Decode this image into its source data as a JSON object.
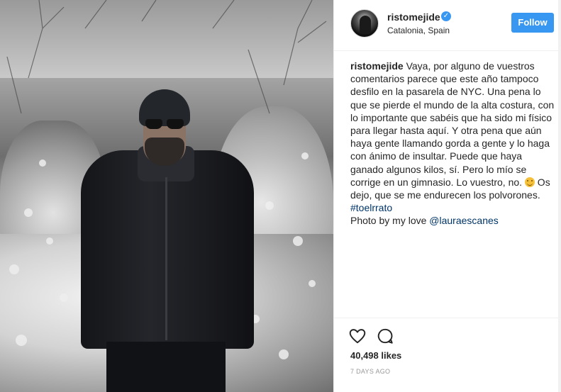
{
  "post": {
    "username": "ristomejide",
    "verified_symbol": "✓",
    "location": "Catalonia, Spain",
    "follow_label": "Follow",
    "caption": {
      "author": "ristomejide",
      "text_1": " Vaya, por alguno de vuestros comentarios parece que este año tampoco desfilo en la pasarela de NYC. Una pena lo que se pierde el mundo de la alta costura, con lo importante que sabéis que ha sido mi físico para llegar hasta aquí. Y otra pena que aún haya gente llamando gorda a gente y lo haga con ánimo de insultar. Puede que haya ganado algunos kilos, sí. Pero lo mío se corrige en un gimnasio. Lo vuestro, no. ",
      "text_2": " Os dejo, que se me endurecen los polvorones.",
      "hashtag": "#toelrrato",
      "credit_prefix": "Photo by my love ",
      "credit_mention": "@lauraescanes"
    },
    "likes": "40,498 likes",
    "time": "7 DAYS AGO"
  },
  "icons": {
    "like": "heart-icon",
    "comment": "comment-icon",
    "emoji": "smile-emoji-icon"
  },
  "colors": {
    "accent": "#3897f0",
    "link": "#003569",
    "muted": "#999999"
  }
}
